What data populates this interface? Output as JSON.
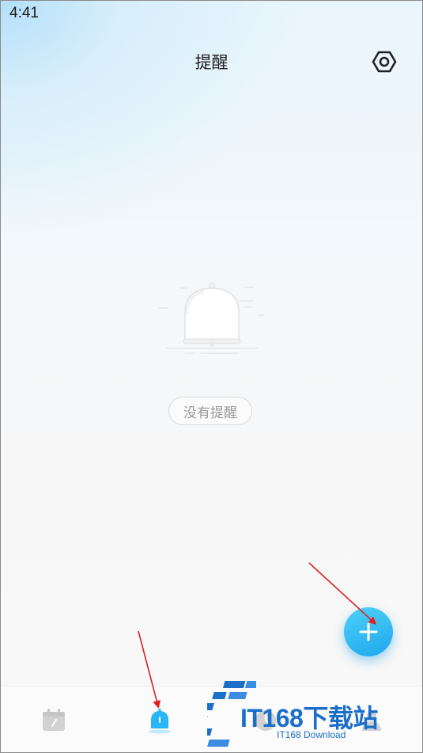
{
  "status_bar": {
    "time": "4:41"
  },
  "header": {
    "title": "提醒",
    "settings_icon": "gear-icon"
  },
  "empty_state": {
    "illustration_icon": "bell-icon",
    "label": "没有提醒"
  },
  "fab": {
    "icon": "plus-icon",
    "color": "#29b6f6"
  },
  "tab_bar": {
    "active_color": "#29b6f6",
    "inactive_color": "#cfcfcf",
    "items": [
      {
        "icon": "calendar-icon",
        "active": false
      },
      {
        "icon": "bell-icon",
        "active": true
      },
      {
        "icon": "clock-icon",
        "active": false
      },
      {
        "icon": "person-icon",
        "active": false
      }
    ]
  },
  "watermark": {
    "brand": "IT168下载站",
    "subtitle": "IT168 Download"
  },
  "annotations": {
    "arrow_color": "#e02020"
  }
}
